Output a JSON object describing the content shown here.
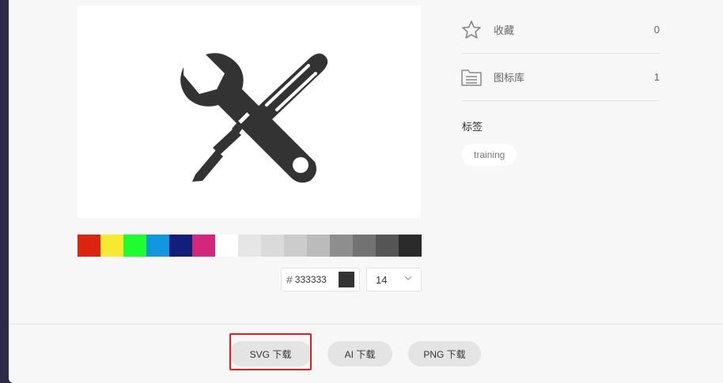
{
  "icon": {
    "name": "tools-icon",
    "color": "#333333"
  },
  "palette": [
    "#dc2511",
    "#f5ea2f",
    "#1ffd31",
    "#1396dd",
    "#121f7a",
    "#d4267b",
    "#ffffff",
    "#e6e6e6",
    "#dadada",
    "#cccccc",
    "#bbbbbb",
    "#8e8e8e",
    "#727272",
    "#555555",
    "#2b2b2b"
  ],
  "color_picker": {
    "hash": "#",
    "value": "333333",
    "chip_color": "#333333"
  },
  "size_select": {
    "value": "14"
  },
  "meta": {
    "favorites": {
      "label": "收藏",
      "count": "0",
      "icon": "star-outline-icon"
    },
    "libraries": {
      "label": "图标库",
      "count": "1",
      "icon": "folder-list-icon"
    }
  },
  "tags": {
    "title": "标签",
    "items": [
      "training"
    ]
  },
  "downloads": {
    "svg": "SVG 下载",
    "ai": "AI 下载",
    "png": "PNG 下载"
  },
  "highlight_color": "#e0201e"
}
